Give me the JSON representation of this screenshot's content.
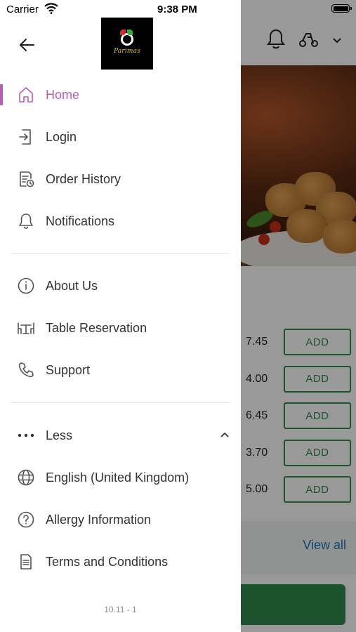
{
  "status_bar": {
    "carrier": "Carrier",
    "time": "9:38 PM"
  },
  "drawer": {
    "logo_text": "Parimas",
    "menu_primary": [
      {
        "label": "Home",
        "icon": "home-icon",
        "active": true
      },
      {
        "label": "Login",
        "icon": "login-icon",
        "active": false
      },
      {
        "label": "Order History",
        "icon": "order-history-icon",
        "active": false
      },
      {
        "label": "Notifications",
        "icon": "bell-icon",
        "active": false
      }
    ],
    "menu_secondary": [
      {
        "label": "About Us",
        "icon": "info-icon"
      },
      {
        "label": "Table Reservation",
        "icon": "table-icon"
      },
      {
        "label": "Support",
        "icon": "phone-icon"
      }
    ],
    "less_label": "Less",
    "menu_tertiary": [
      {
        "label": "English (United Kingdom)",
        "icon": "globe-icon"
      },
      {
        "label": "Allergy Information",
        "icon": "question-icon"
      },
      {
        "label": "Terms and Conditions",
        "icon": "document-icon"
      }
    ],
    "version": "10.11 - 1"
  },
  "background": {
    "items": [
      {
        "price": "7.45",
        "button": "ADD"
      },
      {
        "price": "4.00",
        "button": "ADD"
      },
      {
        "price": "6.45",
        "button": "ADD"
      },
      {
        "price": "3.70",
        "button": "ADD"
      },
      {
        "price": "5.00",
        "button": "ADD"
      }
    ],
    "view_all": "View all"
  },
  "colors": {
    "accent": "#b85fb3",
    "add_green": "#2f8a4e",
    "link_blue": "#1f77b4"
  }
}
